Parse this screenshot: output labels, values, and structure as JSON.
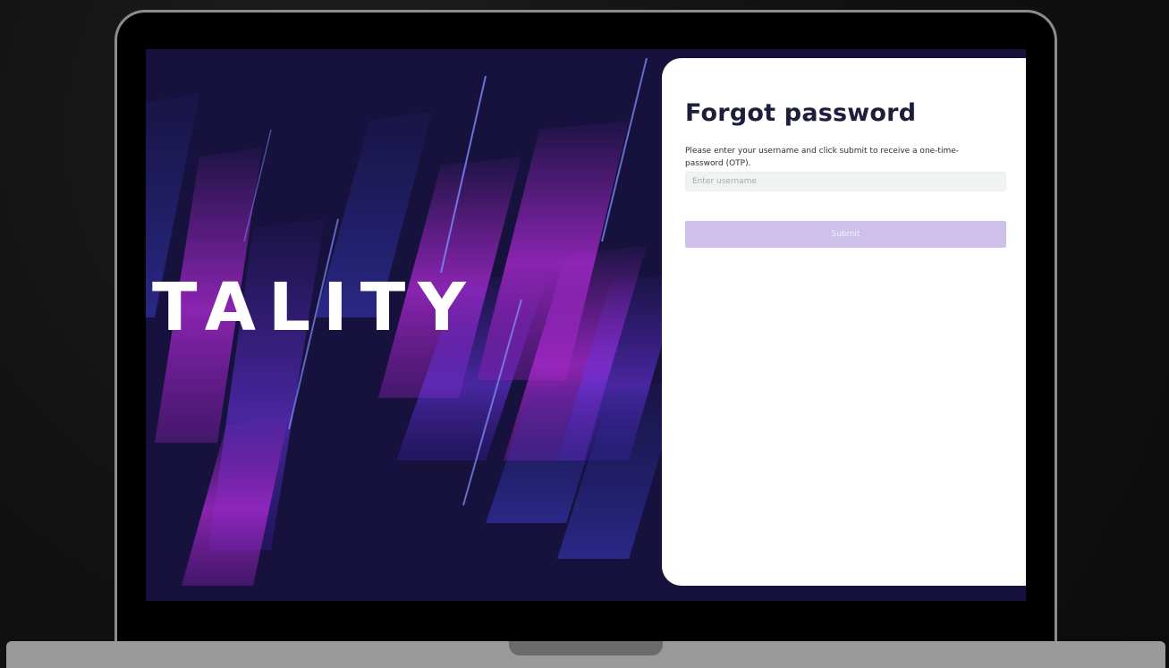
{
  "hero": {
    "brand_text": "TALITY"
  },
  "form": {
    "title": "Forgot password",
    "description": "Please enter your username and click submit to receive a one-time-password (OTP).",
    "username_placeholder": "Enter username",
    "username_value": "",
    "submit_label": "Submit"
  },
  "colors": {
    "card_background": "#ffffff",
    "title_color": "#1c1e3c",
    "submit_button": "#cdc1ec",
    "hero_base": "#1a1240",
    "hero_accent_magenta": "#b02ad6",
    "hero_accent_violet": "#5a2bd1",
    "laptop_frame": "#8c8c8c",
    "laptop_base": "#9a9a9a"
  }
}
